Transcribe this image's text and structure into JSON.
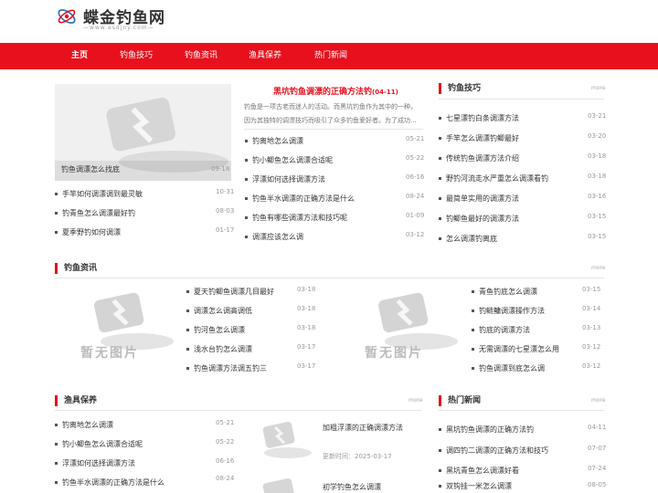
{
  "site": {
    "name": "蝶金钓鱼网",
    "url": "www.esdjny.com"
  },
  "nav": [
    "主页",
    "钓鱼技巧",
    "钓鱼资讯",
    "渔具保养",
    "热门新闻"
  ],
  "placeholder_text": "暂无图片",
  "more": "more",
  "top_left": {
    "caption": "钓鱼调漂怎么找底",
    "caption_date": "09-18",
    "items": [
      {
        "title": "手竿如何调漂调到最灵敏",
        "date": "10-31"
      },
      {
        "title": "钓青鱼怎么调漂最好钓",
        "date": "08-03"
      },
      {
        "title": "夏季野钓如何调漂",
        "date": "01-17"
      }
    ]
  },
  "headline": {
    "title": "黑坑钓鱼调漂的正确方法钓",
    "date": "(04-11)",
    "summary_1": "钓鱼是一项古老而迷人的活动。而黑坑钓鱼作为其中的一种，",
    "summary_2": "因为其独特的调漂技巧而吸引了众多钓鱼爱好者。为了成功..."
  },
  "mid_list": [
    {
      "title": "钓离地怎么调漂",
      "date": "05-21"
    },
    {
      "title": "钓小鲫鱼怎么调漂合适呢",
      "date": "05-22"
    },
    {
      "title": "浮漂如何选择调漂方法",
      "date": "06-16"
    },
    {
      "title": "钓鱼半水调漂的正确方法是什么",
      "date": "08-24"
    },
    {
      "title": "钓鱼有哪些调漂方法和技巧呢",
      "date": "01-09"
    },
    {
      "title": "调漂应该怎么调",
      "date": "03-12"
    }
  ],
  "skills": {
    "title": "钓鱼技巧",
    "items": [
      {
        "title": "七星漂钓白条调漂方法",
        "date": "03-21"
      },
      {
        "title": "手竿怎么调漂钓鲫最好",
        "date": "03-20"
      },
      {
        "title": "传统钓鱼调漂方法介绍",
        "date": "03-18"
      },
      {
        "title": "野钓河流走水严重怎么调漂看钓",
        "date": "03-18"
      },
      {
        "title": "最简单实用的调漂方法",
        "date": "03-16"
      },
      {
        "title": "钓鲫鱼最好的调漂方法",
        "date": "03-15"
      },
      {
        "title": "怎么调漂钓离底",
        "date": "03-15"
      }
    ]
  },
  "news": {
    "title": "钓鱼资讯",
    "list1": [
      {
        "title": "夏天钓鲫鱼调漂几目最好",
        "date": "03-18"
      },
      {
        "title": "调漂怎么调高调低",
        "date": "03-18"
      },
      {
        "title": "钓河鱼怎么调漂",
        "date": "03-18"
      },
      {
        "title": "浅水台钓怎么调漂",
        "date": "03-17"
      },
      {
        "title": "钓鱼调漂方法调五钓三",
        "date": "03-17"
      }
    ],
    "list2": [
      {
        "title": "青鱼钓底怎么调漂",
        "date": "03-15"
      },
      {
        "title": "钓鲢鳙调漂操作方法",
        "date": "03-14"
      },
      {
        "title": "钓底的调漂方法",
        "date": "03-13"
      },
      {
        "title": "无需调漂的七星漂怎么用",
        "date": "03-12"
      },
      {
        "title": "钓鱼调漂到底怎么调",
        "date": "03-12"
      }
    ]
  },
  "gear": {
    "title": "渔具保养",
    "items": [
      {
        "title": "钓离地怎么调漂",
        "date": "05-21"
      },
      {
        "title": "钓小鲫鱼怎么调漂合适呢",
        "date": "05-22"
      },
      {
        "title": "浮漂如何选择调漂方法",
        "date": "06-16"
      },
      {
        "title": "钓鱼半水调漂的正确方法是什么",
        "date": "08-24"
      }
    ],
    "feature1_title": "加粗浮漂的正确调漂方法",
    "feature1_meta": "更新时间：2025-03-17",
    "feature2_title": "初学钓鱼怎么调漂"
  },
  "hot": {
    "title": "热门新闻",
    "items": [
      {
        "title": "黑坑钓鱼调漂的正确方法钓",
        "date": "04-11"
      },
      {
        "title": "调四钓二调漂的正确方法和技巧",
        "date": "07-07"
      },
      {
        "title": "黑坑青鱼怎么调漂好看",
        "date": "07-24"
      },
      {
        "title": "双钩挂一米怎么调漂",
        "date": "08-05"
      }
    ]
  }
}
